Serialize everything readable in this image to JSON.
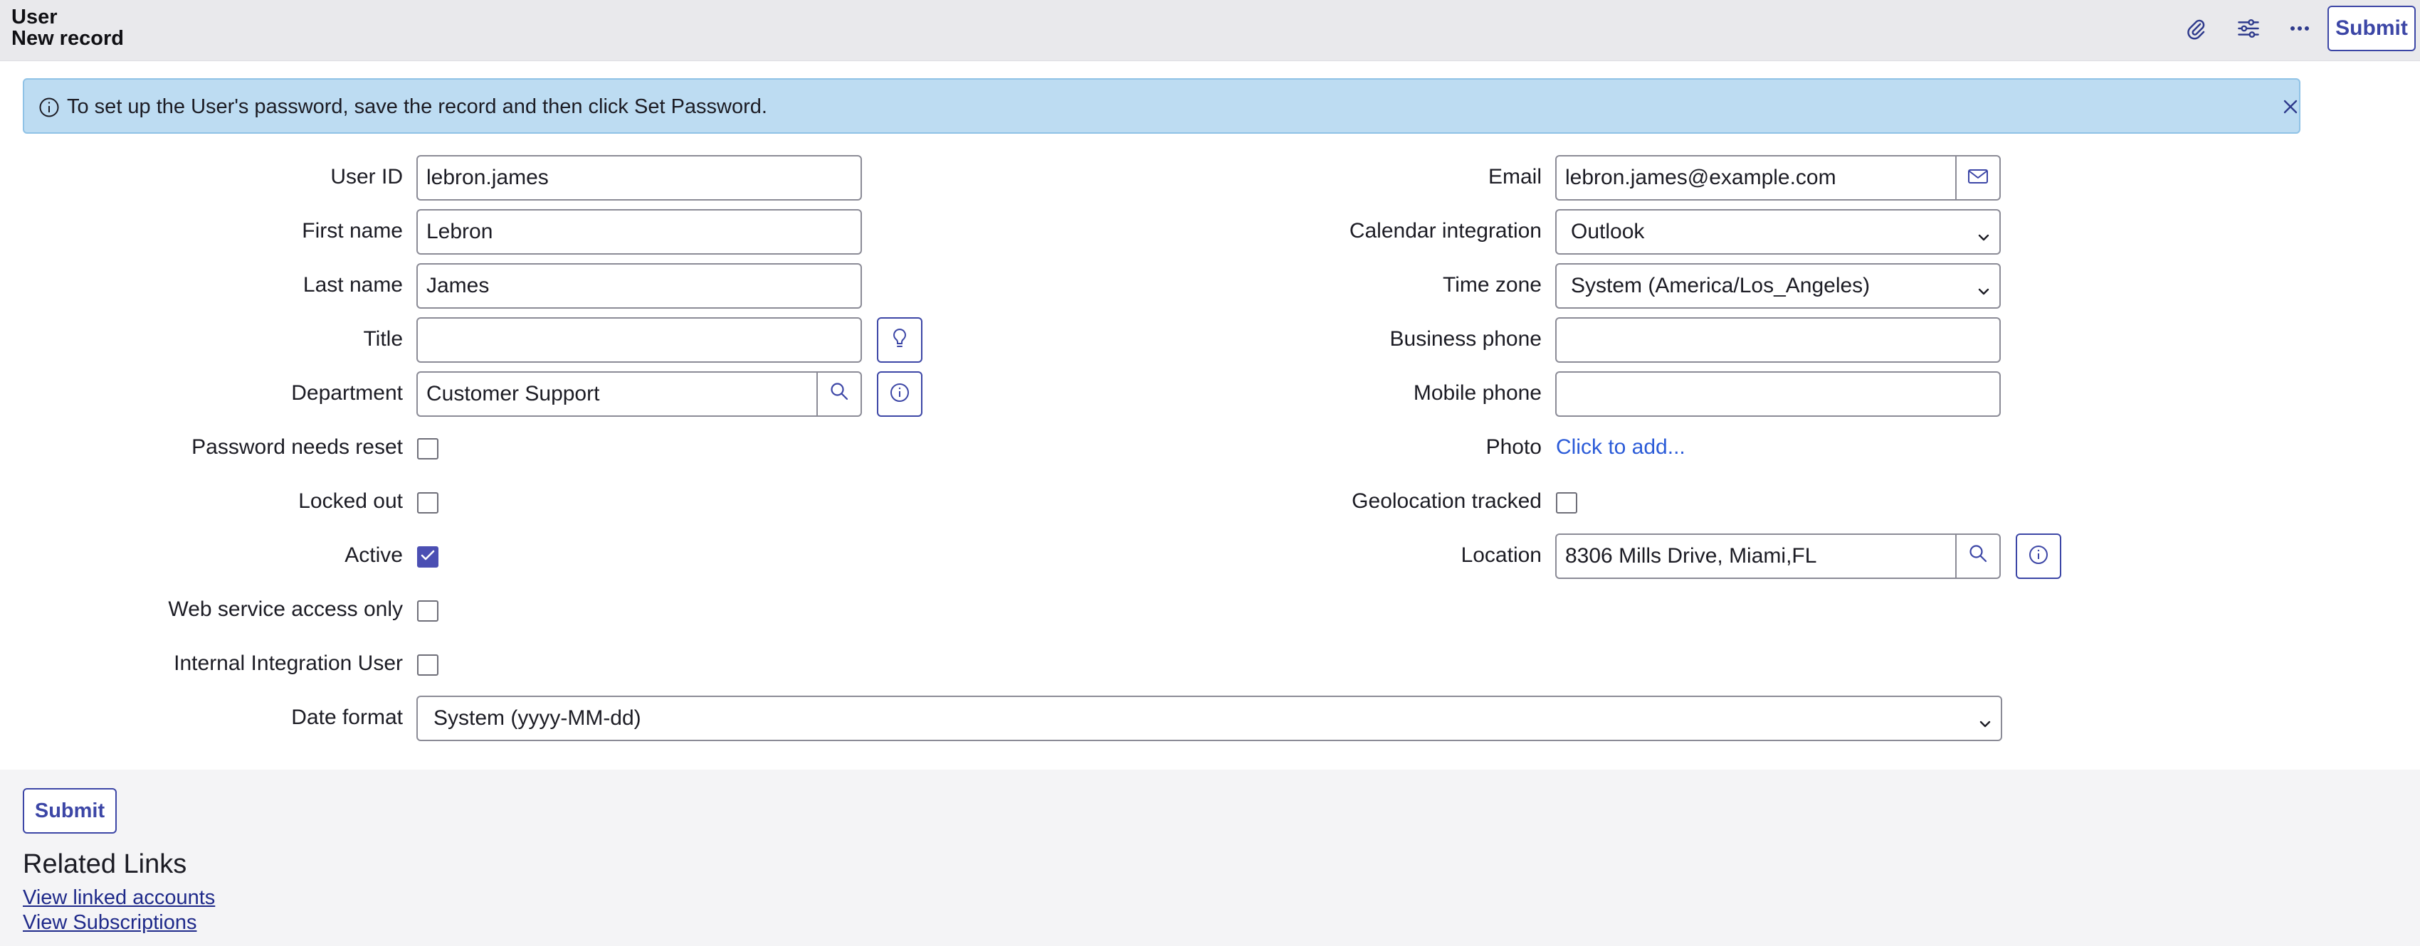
{
  "header": {
    "table": "User",
    "record": "New record",
    "icons": [
      "paperclip-icon",
      "sliders-icon",
      "more-icon"
    ],
    "submit_label": "Submit"
  },
  "banner": {
    "message": "To set up the User's password, save the record and then click Set Password."
  },
  "form": {
    "user_id": {
      "label": "User ID",
      "value": "lebron.james"
    },
    "first_name": {
      "label": "First name",
      "value": "Lebron"
    },
    "last_name": {
      "label": "Last name",
      "value": "James"
    },
    "title": {
      "label": "Title",
      "value": ""
    },
    "department": {
      "label": "Department",
      "value": "Customer Support"
    },
    "password_needs_reset": {
      "label": "Password needs reset",
      "checked": false
    },
    "locked_out": {
      "label": "Locked out",
      "checked": false
    },
    "active": {
      "label": "Active",
      "checked": true
    },
    "web_service_access_only": {
      "label": "Web service access only",
      "checked": false
    },
    "internal_integration_user": {
      "label": "Internal Integration User",
      "checked": false
    },
    "date_format": {
      "label": "Date format",
      "value": "System (yyyy-MM-dd)"
    },
    "email": {
      "label": "Email",
      "value": "lebron.james@example.com"
    },
    "calendar_integration": {
      "label": "Calendar integration",
      "value": "Outlook"
    },
    "time_zone": {
      "label": "Time zone",
      "value": "System (America/Los_Angeles)"
    },
    "business_phone": {
      "label": "Business phone",
      "value": ""
    },
    "mobile_phone": {
      "label": "Mobile phone",
      "value": ""
    },
    "photo": {
      "label": "Photo",
      "link": "Click to add..."
    },
    "geolocation_tracked": {
      "label": "Geolocation tracked",
      "checked": false
    },
    "location": {
      "label": "Location",
      "value": "8306 Mills Drive, Miami,FL"
    }
  },
  "footer": {
    "submit_label": "Submit",
    "related_title": "Related Links",
    "links": [
      "View linked accounts",
      "View Subscriptions"
    ]
  },
  "colors": {
    "accent": "#3c46a6",
    "banner_bg": "#bddcf2",
    "checkbox_checked": "#4b4fb3",
    "link": "#2b5bd8"
  }
}
